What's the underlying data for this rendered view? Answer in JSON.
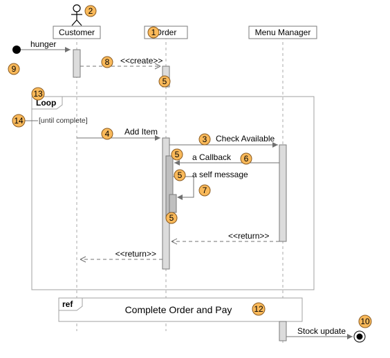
{
  "lifelines": {
    "customer": "Customer",
    "order": "Order",
    "menu": "Menu Manager"
  },
  "messages": {
    "hunger": "hunger",
    "create": "<<create>>",
    "add_item": "Add Item",
    "check_available": "Check Available",
    "callback": "a Callback",
    "self_msg": "a self message",
    "return": "<<return>>",
    "stock_update": "Stock update"
  },
  "fragment": {
    "label": "Loop",
    "guard": "[until complete]"
  },
  "ref": {
    "label": "ref",
    "text": "Complete Order and Pay"
  },
  "callouts": {
    "1": "1",
    "2": "2",
    "3": "3",
    "4": "4",
    "5": "5",
    "6": "6",
    "7": "7",
    "8": "8",
    "9": "9",
    "10": "10",
    "12": "12",
    "13": "13",
    "14": "14"
  },
  "chart_data": {
    "type": "uml-sequence",
    "title": "",
    "lifelines": [
      {
        "id": "customer",
        "label": "Customer",
        "kind": "actor",
        "callout": 2
      },
      {
        "id": "order",
        "label": "Order",
        "kind": "object",
        "callout": 1
      },
      {
        "id": "menu",
        "label": "Menu Manager",
        "kind": "object"
      }
    ],
    "start_event": {
      "to": "customer",
      "label": "hunger",
      "callout": 9
    },
    "end_event": {
      "from": "menu",
      "label": "Stock update",
      "callout": 10
    },
    "messages": [
      {
        "from": "customer",
        "to": "order",
        "label": "<<create>>",
        "style": "dashed-open",
        "callout": 8
      },
      {
        "from": "customer",
        "to": "order",
        "label": "Add Item",
        "style": "solid",
        "callout": 4,
        "in_fragment": "loop"
      },
      {
        "from": "order",
        "to": "menu",
        "label": "Check Available",
        "style": "solid",
        "callout": 3,
        "in_fragment": "loop"
      },
      {
        "from": "menu",
        "to": "order",
        "label": "a Callback",
        "style": "solid",
        "callout": 6,
        "in_fragment": "loop"
      },
      {
        "from": "order",
        "to": "order",
        "label": "a self message",
        "style": "self",
        "callout": 7,
        "in_fragment": "loop"
      },
      {
        "from": "menu",
        "to": "order",
        "label": "<<return>>",
        "style": "dashed-open",
        "in_fragment": "loop"
      },
      {
        "from": "order",
        "to": "customer",
        "label": "<<return>>",
        "style": "dashed-open",
        "in_fragment": "loop"
      }
    ],
    "activation_callouts": [
      5,
      5,
      5,
      5
    ],
    "fragments": [
      {
        "kind": "loop",
        "label": "Loop",
        "guard": "[until complete]",
        "callout_label": 13,
        "callout_guard": 14
      }
    ],
    "refs": [
      {
        "label": "ref",
        "text": "Complete Order and Pay",
        "callout": 12
      }
    ]
  }
}
